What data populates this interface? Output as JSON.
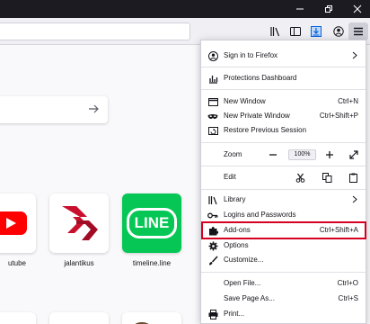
{
  "top_sites": [
    {
      "label": "utube",
      "icon": "youtube-icon"
    },
    {
      "label": "jalantikus",
      "icon": "jalantikus-icon"
    },
    {
      "label": "timeline.line",
      "icon": "line-icon",
      "logo_text": "LINE"
    }
  ],
  "menu": {
    "sign_in": "Sign in to Firefox",
    "protections": "Protections Dashboard",
    "new_window": {
      "label": "New Window",
      "shortcut": "Ctrl+N"
    },
    "new_private": {
      "label": "New Private Window",
      "shortcut": "Ctrl+Shift+P"
    },
    "restore": "Restore Previous Session",
    "zoom": {
      "label": "Zoom",
      "value": "100%"
    },
    "edit": "Edit",
    "library": "Library",
    "logins": "Logins and Passwords",
    "addons": {
      "label": "Add-ons",
      "shortcut": "Ctrl+Shift+A"
    },
    "options": "Options",
    "customize": "Customize...",
    "open_file": {
      "label": "Open File...",
      "shortcut": "Ctrl+O"
    },
    "save_page": {
      "label": "Save Page As...",
      "shortcut": "Ctrl+S"
    },
    "print": {
      "label": "Print...",
      "shortcut": ""
    }
  },
  "colors": {
    "highlight": "#d70022",
    "line_green": "#06c755",
    "youtube_red": "#ff0000",
    "jalantikus_red": "#c8102e"
  }
}
